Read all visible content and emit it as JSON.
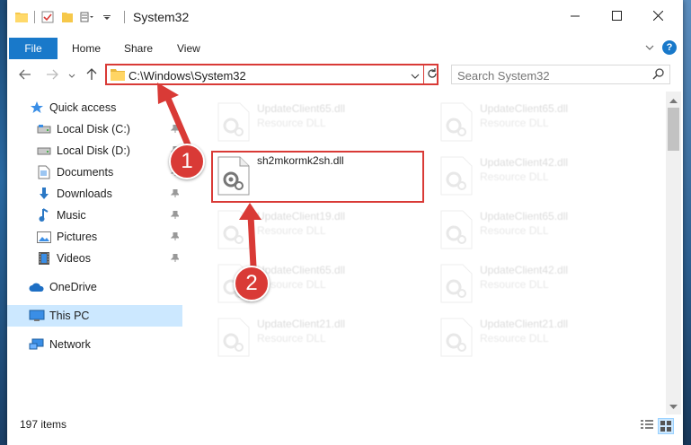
{
  "window": {
    "title": "System32",
    "controls": {
      "minimize": "minimize-icon",
      "maximize": "maximize-icon",
      "close": "close-icon"
    }
  },
  "ribbon": {
    "tabs": [
      {
        "label": "File",
        "active": true
      },
      {
        "label": "Home"
      },
      {
        "label": "Share"
      },
      {
        "label": "View"
      }
    ],
    "help_label": "?"
  },
  "nav": {
    "address_path": "C:\\Windows\\System32",
    "search_placeholder": "Search System32"
  },
  "sidebar": {
    "items": [
      {
        "label": "Quick access",
        "icon": "star-icon",
        "pinned": false
      },
      {
        "label": "Local Disk (C:)",
        "icon": "drive-icon",
        "pinned": true
      },
      {
        "label": "Local Disk (D:)",
        "icon": "drive-icon",
        "pinned": true
      },
      {
        "label": "Documents",
        "icon": "documents-icon",
        "pinned": true
      },
      {
        "label": "Downloads",
        "icon": "download-icon",
        "pinned": true
      },
      {
        "label": "Music",
        "icon": "music-icon",
        "pinned": true
      },
      {
        "label": "Pictures",
        "icon": "pictures-icon",
        "pinned": true
      },
      {
        "label": "Videos",
        "icon": "videos-icon",
        "pinned": true
      },
      {
        "label": "OneDrive",
        "icon": "cloud-icon",
        "pinned": false
      },
      {
        "label": "This PC",
        "icon": "computer-icon",
        "pinned": false,
        "selected": true
      },
      {
        "label": "Network",
        "icon": "network-icon",
        "pinned": false
      }
    ]
  },
  "files": [
    {
      "name": "UpdateClient65.dll",
      "type": "Resource DLL",
      "faded": true
    },
    {
      "name": "UpdateClient65.dll",
      "type": "Resource DLL",
      "faded": true
    },
    {
      "name": "sh2mkormk2sh.dll",
      "type": "",
      "faded": false
    },
    {
      "name": "UpdateClient42.dll",
      "type": "Resource DLL",
      "faded": true
    },
    {
      "name": "UpdateClient19.dll",
      "type": "Resource DLL",
      "faded": true
    },
    {
      "name": "UpdateClient65.dll",
      "type": "Resource DLL",
      "faded": true
    },
    {
      "name": "UpdateClient65.dll",
      "type": "Resource DLL",
      "faded": true
    },
    {
      "name": "UpdateClient42.dll",
      "type": "Resource DLL",
      "faded": true
    },
    {
      "name": "UpdateClient21.dll",
      "type": "Resource DLL",
      "faded": true
    },
    {
      "name": "UpdateClient21.dll",
      "type": "Resource DLL",
      "faded": true
    }
  ],
  "status": {
    "item_count": "197 items"
  },
  "annotations": {
    "step1": "1",
    "step2": "2",
    "color": "#d93a36"
  }
}
